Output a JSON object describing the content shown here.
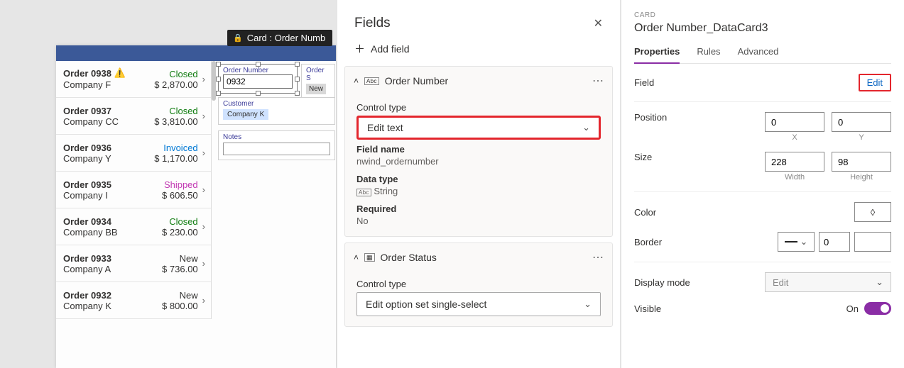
{
  "canvas": {
    "tooltip": "Card : Order Numb",
    "order_number_card": {
      "label": "Order Number",
      "value": "0932"
    },
    "order_status_card": {
      "label": "Order S",
      "value": "New"
    },
    "customer_card": {
      "label": "Customer",
      "value": "Company K"
    },
    "notes_card": {
      "label": "Notes"
    },
    "orders": [
      {
        "title": "Order 0938",
        "warn": true,
        "company": "Company F",
        "status": "Closed",
        "status_cls": "closed",
        "amount": "$ 2,870.00"
      },
      {
        "title": "Order 0937",
        "company": "Company CC",
        "status": "Closed",
        "status_cls": "closed",
        "amount": "$ 3,810.00"
      },
      {
        "title": "Order 0936",
        "company": "Company Y",
        "status": "Invoiced",
        "status_cls": "invoiced",
        "amount": "$ 1,170.00"
      },
      {
        "title": "Order 0935",
        "company": "Company I",
        "status": "Shipped",
        "status_cls": "shipped",
        "amount": "$ 606.50"
      },
      {
        "title": "Order 0934",
        "company": "Company BB",
        "status": "Closed",
        "status_cls": "closed",
        "amount": "$ 230.00"
      },
      {
        "title": "Order 0933",
        "company": "Company A",
        "status": "New",
        "status_cls": "new",
        "amount": "$ 736.00"
      },
      {
        "title": "Order 0932",
        "company": "Company K",
        "status": "New",
        "status_cls": "new",
        "amount": "$ 800.00"
      }
    ]
  },
  "fields_panel": {
    "title": "Fields",
    "add_field": "Add field",
    "order_number": {
      "header": "Order Number",
      "control_type_label": "Control type",
      "control_type_value": "Edit text",
      "field_name_label": "Field name",
      "field_name_value": "nwind_ordernumber",
      "data_type_label": "Data type",
      "data_type_value": "String",
      "required_label": "Required",
      "required_value": "No"
    },
    "order_status": {
      "header": "Order Status",
      "control_type_label": "Control type",
      "control_type_value": "Edit option set single-select"
    }
  },
  "props_panel": {
    "eyebrow": "CARD",
    "title": "Order Number_DataCard3",
    "tabs": {
      "properties": "Properties",
      "rules": "Rules",
      "advanced": "Advanced"
    },
    "field_label": "Field",
    "edit_link": "Edit",
    "position_label": "Position",
    "pos_x": "0",
    "pos_y": "0",
    "x_sub": "X",
    "y_sub": "Y",
    "size_label": "Size",
    "width": "228",
    "height": "98",
    "w_sub": "Width",
    "h_sub": "Height",
    "color_label": "Color",
    "border_label": "Border",
    "border_width": "0",
    "display_mode_label": "Display mode",
    "display_mode_value": "Edit",
    "visible_label": "Visible",
    "visible_value": "On"
  }
}
